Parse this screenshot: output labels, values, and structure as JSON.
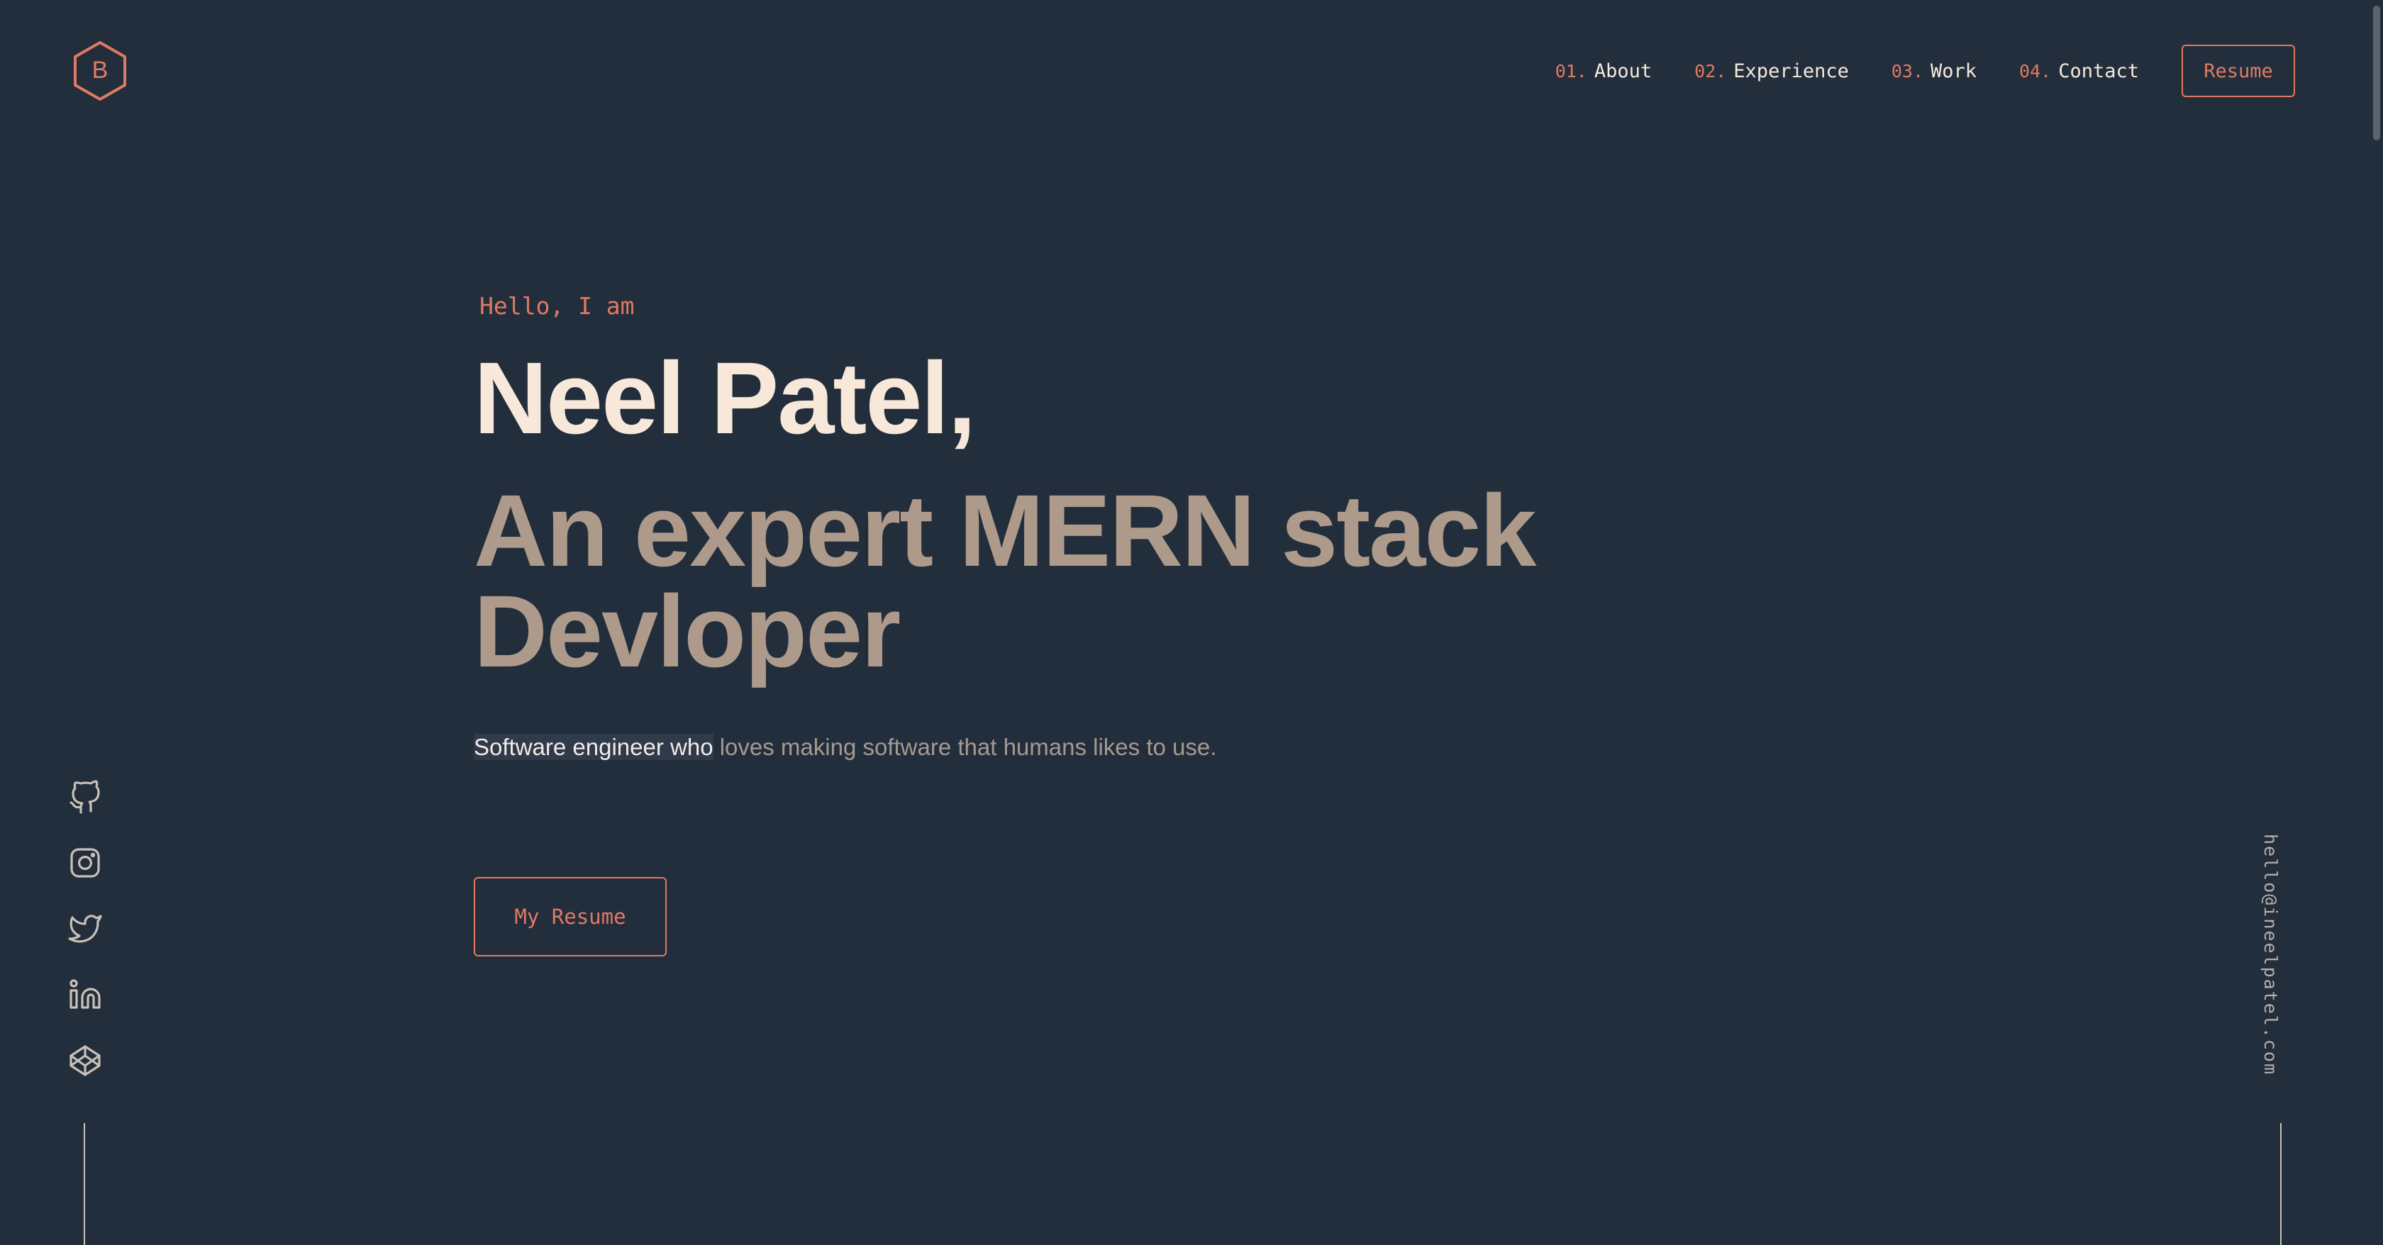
{
  "logo": {
    "letter": "B",
    "accent": "#e07a62"
  },
  "nav": {
    "items": [
      {
        "num": "01.",
        "label": "About"
      },
      {
        "num": "02.",
        "label": "Experience"
      },
      {
        "num": "03.",
        "label": "Work"
      },
      {
        "num": "04.",
        "label": "Contact"
      }
    ],
    "resume_label": "Resume"
  },
  "hero": {
    "greeting": "Hello, I am",
    "name": "Neel Patel,",
    "tagline": "An expert MERN stack Devloper",
    "description_highlight": "Software engineer who",
    "description_rest": " loves making software that humans likes to use.",
    "button_label": "My Resume"
  },
  "social": {
    "icons": [
      "github-icon",
      "instagram-icon",
      "twitter-icon",
      "linkedin-icon",
      "codepen-icon"
    ]
  },
  "email": "hello@ineelpatel.com",
  "colors": {
    "background": "#232e3c",
    "accent": "#e07a62",
    "heading": "#f7e8da",
    "subheading": "#ad9a8a",
    "text": "#a69a90"
  }
}
